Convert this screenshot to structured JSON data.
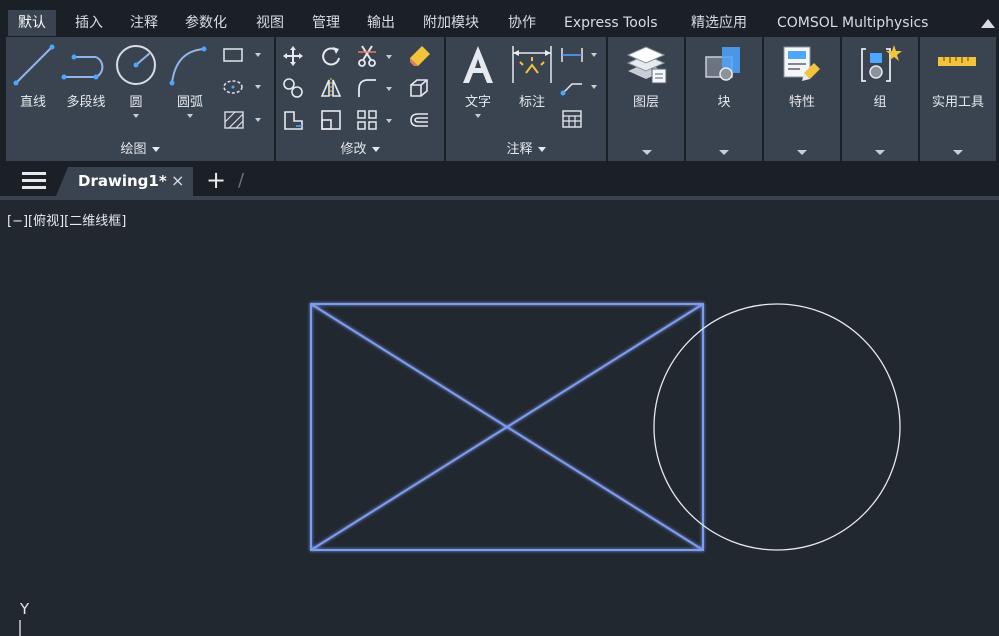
{
  "ribbon_tabs": [
    "默认",
    "插入",
    "注释",
    "参数化",
    "视图",
    "管理",
    "输出",
    "附加模块",
    "协作",
    "Express Tools",
    "精选应用",
    "COMSOL Multiphysics"
  ],
  "active_tab": "默认",
  "draw_panel": {
    "title": "绘图",
    "tools": [
      "直线",
      "多段线",
      "圆",
      "圆弧"
    ]
  },
  "modify_panel": {
    "title": "修改"
  },
  "annotation_panel": {
    "title": "注释",
    "tools": [
      "文字",
      "标注"
    ]
  },
  "layers_panel": {
    "title": "图层"
  },
  "block_panel": {
    "title": "块"
  },
  "properties_panel": {
    "title": "特性"
  },
  "groups_panel": {
    "title": "组"
  },
  "utilities_panel": {
    "title": "实用工具"
  },
  "file_tab": {
    "label": "Drawing1*",
    "close": "×"
  },
  "new_tab": "+",
  "viewport_label": "[−][俯视][二维线框]",
  "ucs_axis": "Y",
  "colors": {
    "background": "#212830",
    "ribbon": "#3a4350",
    "selected_geometry": "#7e9cf2",
    "geometry": "#e6e9ee",
    "accent_yellow": "#f3c33c"
  },
  "drawing": {
    "rectangle": {
      "selected": true
    },
    "diagonals": {
      "count": 2,
      "selected": true
    },
    "circle": {
      "selected": false
    }
  }
}
